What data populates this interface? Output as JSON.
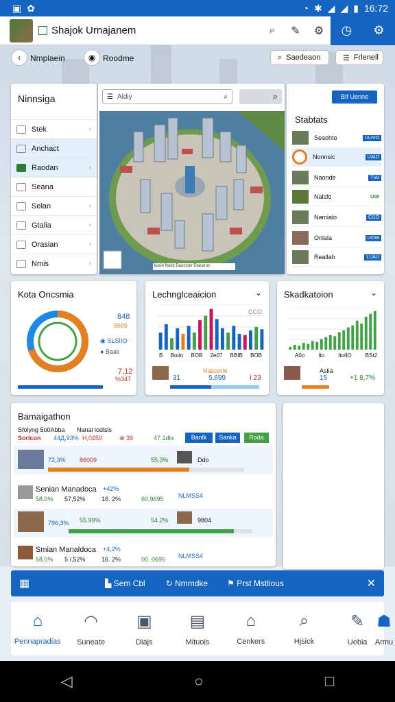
{
  "status_bar": {
    "time": "16:72"
  },
  "app": {
    "title": "Shajok Urnajanem"
  },
  "subnav": {
    "back_label": "Nmplaein",
    "item2_label": "Roodme",
    "btn1_label": "Saedeaon",
    "btn2_label": "Frlenell"
  },
  "nav_list": {
    "title": "Ninnsiga",
    "items": [
      {
        "label": "Stek"
      },
      {
        "label": "Anchact"
      },
      {
        "label": "Raodan"
      },
      {
        "label": "Seana"
      },
      {
        "label": "Selan"
      },
      {
        "label": "Gtalia"
      },
      {
        "label": "Orasian"
      },
      {
        "label": "Nmis"
      }
    ]
  },
  "map": {
    "search_placeholder": "Aldiy",
    "caption": "kasin Nalot Daoctoer Etacerus"
  },
  "stats": {
    "button": "BIf Uenne",
    "title": "Stabtats",
    "rows": [
      {
        "label": "Seaohto",
        "tag": "ULIVO"
      },
      {
        "label": "Nonnsic",
        "tag": "UAIO"
      },
      {
        "label": "Naonde",
        "tag": "TIAI"
      },
      {
        "label": "Nalsfo",
        "tag": "U00"
      },
      {
        "label": "Namialo",
        "tag": "CIJO"
      },
      {
        "label": "Onlala",
        "tag": "UOW"
      },
      {
        "label": "Reallab",
        "tag": "LUAU"
      }
    ]
  },
  "kpi1": {
    "title": "Kota Oncsmia",
    "v1": "848",
    "v2": "8605",
    "l1": "SLSIIO",
    "l2": "Baaii",
    "b1": "7,12",
    "b2": "%347",
    "donut": [
      0.7,
      0.3
    ]
  },
  "kpi2": {
    "title": "Lechnglceaicion",
    "tick_top": "CCO",
    "axis": [
      "B",
      "Bodo",
      "BOB",
      "2e07",
      "BBIB",
      "BOB"
    ],
    "foot1": "31",
    "foot2": "5,699",
    "foot3": "I 23",
    "foot_label": "Hasomlo",
    "chart_data": {
      "type": "bar",
      "values": [
        30,
        45,
        20,
        38,
        28,
        42,
        30,
        52,
        60,
        72,
        54,
        38,
        30,
        42,
        28,
        26,
        34,
        40,
        36
      ]
    }
  },
  "kpi3": {
    "title": "Skadkatoion",
    "axis": [
      "A0o",
      "Ito",
      "ItotIO",
      "BSt2"
    ],
    "foot1": "15",
    "foot2": "+1 8,7%",
    "foot_label": "Aslia",
    "chart_data": {
      "type": "bar",
      "values": [
        6,
        10,
        8,
        14,
        12,
        18,
        16,
        22,
        26,
        30,
        28,
        36,
        40,
        46,
        50,
        60,
        54,
        68,
        74,
        80
      ]
    }
  },
  "summary": {
    "title": "Bamaigathon",
    "sub1": "Sfolyng 5o0Abba",
    "sub2": "Nanal lodlsls",
    "red_label": "Sorlcon",
    "v_a": "44Д,93%",
    "v_b": "H,0250",
    "v_c": "39",
    "v_d": "47.1dts",
    "chip1": "Banlk",
    "chip2": "Sanka",
    "chip3": "Roda",
    "rows": [
      {
        "pct": "72,3%",
        "val": "86009",
        "right": "55,3%",
        "tag": "Ddo",
        "title": "",
        "progress": 0.72
      },
      {
        "title": "Senian Manadoca",
        "pct": "58.0%",
        "val": "57,52%",
        "val2": "16. 2%",
        "right": "60.9695",
        "tag": "NLMSS4",
        "delta": "+42%"
      },
      {
        "pct": "796,3%",
        "val": "55.99%",
        "right": "54.2%",
        "tag": "9804",
        "progress": 0.9
      },
      {
        "title": "Smian Manaldoca",
        "pct": "58.0%",
        "val": "5 /,52%",
        "val2": "16. 2%",
        "right": "00. 0695",
        "tag": "NLMSS4",
        "delta": "+4,2%"
      }
    ]
  },
  "toast": {
    "a": "Sem Cbl",
    "b": "Nmmdke",
    "c": "Prst Mstlious"
  },
  "bottom_nav": {
    "items": [
      {
        "label": "Pennapradias"
      },
      {
        "label": "Suneate"
      },
      {
        "label": "Diajs"
      },
      {
        "label": "Mituois"
      },
      {
        "label": "Cenkers"
      },
      {
        "label": "Hjsick"
      },
      {
        "label": "Uebia"
      },
      {
        "label": "Armu"
      }
    ]
  },
  "colors": {
    "primary": "#1565c0",
    "green": "#2e7d32",
    "orange": "#e67e22",
    "red": "#c62828"
  }
}
